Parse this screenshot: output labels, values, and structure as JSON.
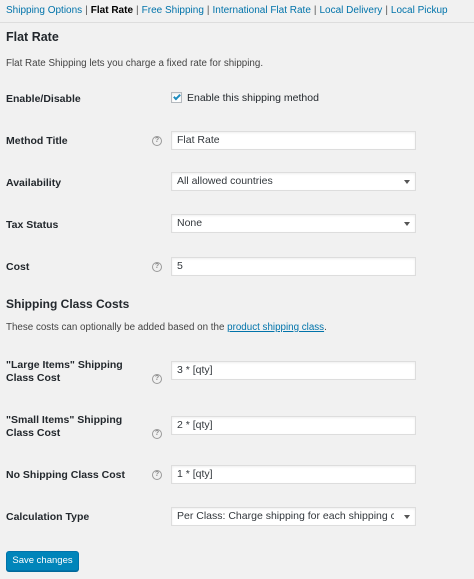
{
  "subnav": [
    {
      "label": "Shipping Options"
    },
    {
      "label": "Flat Rate"
    },
    {
      "label": "Free Shipping"
    },
    {
      "label": "International Flat Rate"
    },
    {
      "label": "Local Delivery"
    },
    {
      "label": "Local Pickup"
    }
  ],
  "subnav_separator": "|",
  "page_title": "Flat Rate",
  "page_description": "Flat Rate Shipping lets you charge a fixed rate for shipping.",
  "fields": {
    "enable": {
      "label": "Enable/Disable",
      "checkbox_label": "Enable this shipping method",
      "checked": true
    },
    "method_title": {
      "label": "Method Title",
      "value": "Flat Rate"
    },
    "availability": {
      "label": "Availability",
      "selected": "All allowed countries"
    },
    "tax_status": {
      "label": "Tax Status",
      "selected": "None"
    },
    "cost": {
      "label": "Cost",
      "value": "5"
    }
  },
  "shipping_class_costs": {
    "heading": "Shipping Class Costs",
    "description_prefix": "These costs can optionally be added based on the ",
    "description_link": "product shipping class",
    "description_suffix": ".",
    "large_items": {
      "label": "\"Large Items\" Shipping Class Cost",
      "value": "3 * [qty]"
    },
    "small_items": {
      "label": "\"Small Items\" Shipping Class Cost",
      "value": "2 * [qty]"
    },
    "no_class": {
      "label": "No Shipping Class Cost",
      "value": "1 * [qty]"
    },
    "calculation_type": {
      "label": "Calculation Type",
      "selected": "Per Class: Charge shipping for each shipping cl..."
    }
  },
  "help_icon_glyph": "?",
  "save_button": "Save changes",
  "colors": {
    "link": "#0073aa",
    "primary_button": "#0085ba",
    "checkbox_tick": "#1e8cbe",
    "background": "#f1f1f1"
  }
}
